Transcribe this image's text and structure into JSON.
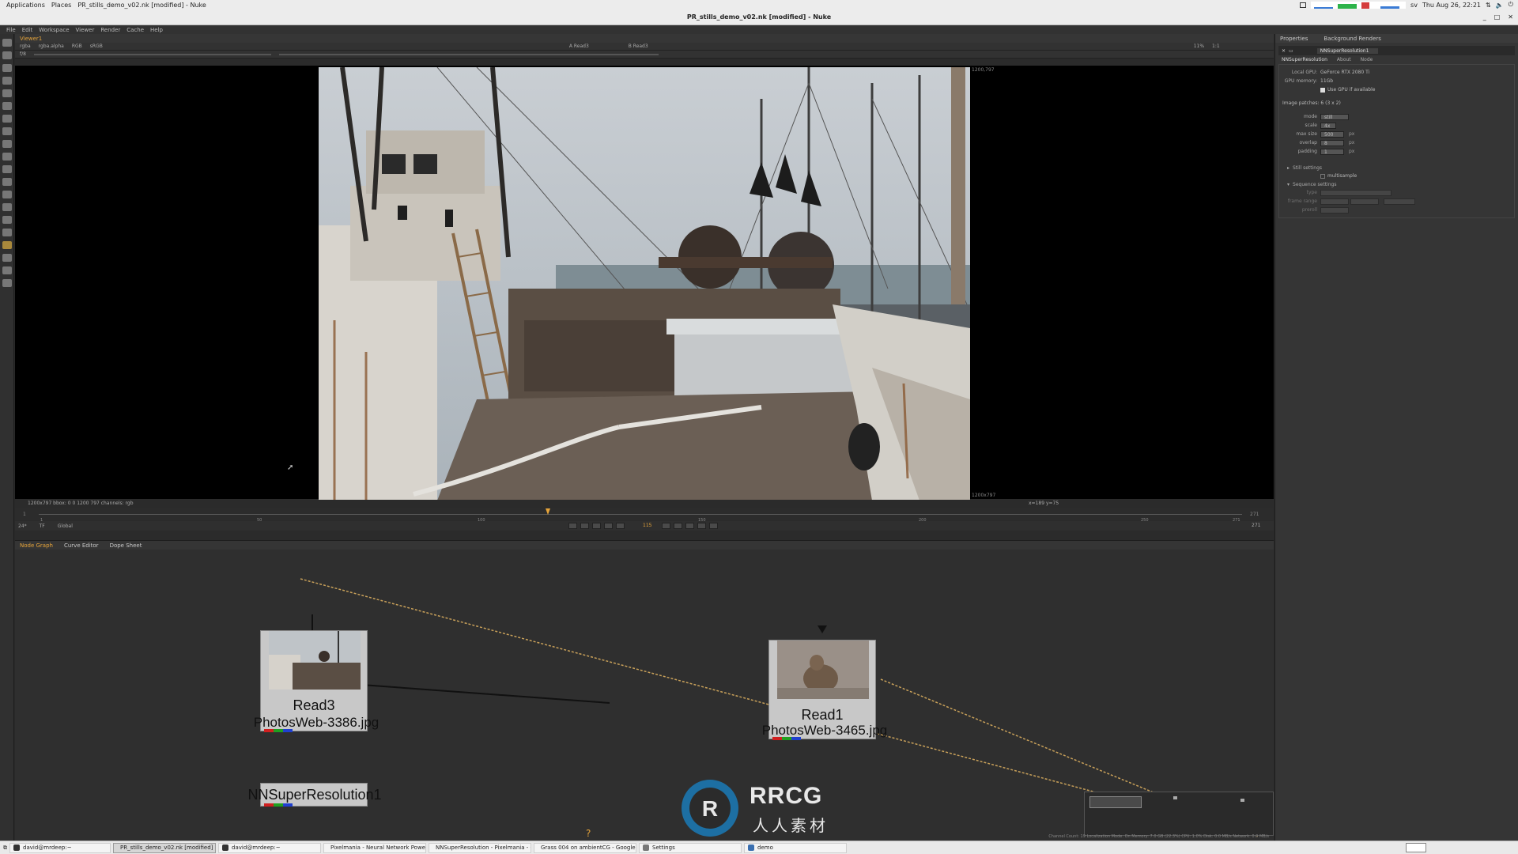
{
  "topbar": {
    "applications": "Applications",
    "places": "Places",
    "window_title": "PR_stills_demo_v02.nk [modified] - Nuke",
    "locale": "sv",
    "datetime": "Thu Aug 26, 22:21"
  },
  "window": {
    "title": "PR_stills_demo_v02.nk [modified] - Nuke"
  },
  "menubar": [
    "File",
    "Edit",
    "Workspace",
    "Viewer",
    "Render",
    "Cache",
    "Help"
  ],
  "viewer": {
    "tab": "Viewer1",
    "channels": "rgba",
    "alpha": "rgba.alpha",
    "colorspace": "RGB",
    "lut": "sRGB",
    "input_a": "A Read3",
    "input_b": "B Read3",
    "zoom": "11%",
    "ratio": "1:1",
    "frame_field": "f/8",
    "coords_top_right": "1200,797",
    "coords_bottom_right": "1200x797",
    "status_left": "1200x797  bbox: 0 0 1200 797 channels: rgb",
    "status_right": "x=189 y=75"
  },
  "timeline": {
    "start": "1",
    "end": "271",
    "ticks": [
      "1",
      "50",
      "100",
      "150",
      "200",
      "250",
      "271"
    ],
    "current_frame": "115",
    "fps": "24*",
    "tf": "TF",
    "scope": "Global",
    "end_field": "271"
  },
  "node_graph": {
    "tabs": [
      "Node Graph",
      "Curve Editor",
      "Dope Sheet"
    ],
    "nodes": [
      {
        "name": "Read3",
        "file": "PhotosWeb-3386.jpg"
      },
      {
        "name": "Read1",
        "file": "PhotosWeb-3465.jpg"
      },
      {
        "name": "NNSuperResolution1"
      }
    ],
    "status": "Channel Count: 19  Localization Mode: On  Memory: 7.0 GB (22.3%)  CPU: 1.0%  Disk: 0.0 MB/s  Network: 0.0 MB/s"
  },
  "properties": {
    "tabs": [
      "Properties",
      "Background Renders"
    ],
    "node_name": "NNSuperResolution1",
    "subtabs": [
      "NNSuperResolution",
      "About",
      "Node"
    ],
    "local_gpu_label": "Local GPU:",
    "local_gpu": "GeForce RTX 2080 Ti",
    "gpu_memory_label": "GPU memory:",
    "gpu_memory": "11Gb",
    "use_gpu": "Use GPU if available",
    "image_patches": "Image patches: 6 (3 x 2)",
    "mode_label": "mode",
    "mode": "still",
    "scale_label": "scale",
    "scale": "4x",
    "max_size_label": "max size",
    "max_size": "500",
    "overlap_label": "overlap",
    "overlap": "8",
    "padding_label": "padding",
    "padding": "1",
    "unit": "px",
    "still_settings": "Still settings",
    "multisample": "multisample",
    "sequence_settings": "Sequence settings",
    "type_label": "type",
    "frame_range_label": "frame range",
    "preroll_label": "preroll"
  },
  "taskbar": [
    {
      "label": "david@mrdeep:~",
      "icon_color": "#333333"
    },
    {
      "label": "PR_stills_demo_v02.nk [modified] ...",
      "icon_color": "#f0b400",
      "active": true
    },
    {
      "label": "david@mrdeep:~",
      "icon_color": "#333333"
    },
    {
      "label": "Pixelmania - Neural Network Power...",
      "icon_color": "#d84a38"
    },
    {
      "label": "NNSuperResolution - Pixelmania - G...",
      "icon_color": "#d84a38"
    },
    {
      "label": "Grass 004 on ambientCG - Google ...",
      "icon_color": "#d84a38"
    },
    {
      "label": "Settings",
      "icon_color": "#777777"
    },
    {
      "label": "demo",
      "icon_color": "#3a6fb0"
    }
  ],
  "watermark": {
    "brand": "RRCG",
    "subtitle": "人人素材"
  },
  "colors": {
    "accent": "#e6a43a",
    "nuke_bg": "#2f2f2f",
    "pipe": "#c9a15a"
  }
}
